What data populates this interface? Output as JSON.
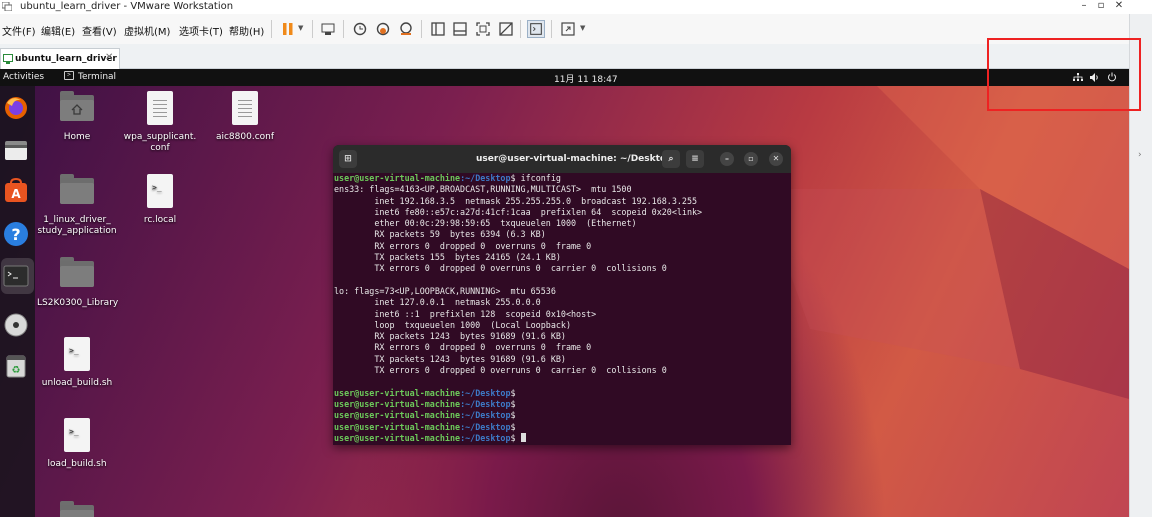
{
  "window": {
    "title": "ubuntu_learn_driver - VMware Workstation"
  },
  "menus": [
    "文件(F)",
    "编辑(E)",
    "查看(V)",
    "虚拟机(M)",
    "选项卡(T)",
    "帮助(H)"
  ],
  "tab": {
    "label": "ubuntu_learn_driver"
  },
  "guest": {
    "topbar": {
      "activities": "Activities",
      "app": "Terminal",
      "clock": "11月 11  18:47"
    },
    "desktop": [
      {
        "label": "Home",
        "kind": "home-folder"
      },
      {
        "label": "wpa_supplicant.\nconf",
        "kind": "document"
      },
      {
        "label": "aic8800.conf",
        "kind": "document"
      },
      {
        "label": "1_linux_driver_\nstudy_application",
        "kind": "folder"
      },
      {
        "label": "rc.local",
        "kind": "script"
      },
      {
        "label": "LS2K0300_Library",
        "kind": "folder"
      },
      {
        "label": "unload_build.sh",
        "kind": "script"
      },
      {
        "label": "load_build.sh",
        "kind": "script"
      }
    ]
  },
  "terminal": {
    "title": "user@user-virtual-machine: ~/Desktop",
    "prompt_user": "user@user-virtual-machine",
    "prompt_path": ":~/Desktop",
    "command": "$ ifconfig",
    "output": [
      "ens33: flags=4163<UP,BROADCAST,RUNNING,MULTICAST>  mtu 1500",
      "        inet 192.168.3.5  netmask 255.255.255.0  broadcast 192.168.3.255",
      "        inet6 fe80::e57c:a27d:41cf:1caa  prefixlen 64  scopeid 0x20<link>",
      "        ether 00:0c:29:98:59:65  txqueuelen 1000  (Ethernet)",
      "        RX packets 59  bytes 6394 (6.3 KB)",
      "        RX errors 0  dropped 0  overruns 0  frame 0",
      "        TX packets 155  bytes 24165 (24.1 KB)",
      "        TX errors 0  dropped 0 overruns 0  carrier 0  collisions 0",
      "",
      "lo: flags=73<UP,LOOPBACK,RUNNING>  mtu 65536",
      "        inet 127.0.0.1  netmask 255.0.0.0",
      "        inet6 ::1  prefixlen 128  scopeid 0x10<host>",
      "        loop  txqueuelen 1000  (Local Loopback)",
      "        RX packets 1243  bytes 91689 (91.6 KB)",
      "        RX errors 0  dropped 0  overruns 0  frame 0",
      "        TX packets 1243  bytes 91689 (91.6 KB)",
      "        TX errors 0  dropped 0 overruns 0  carrier 0  collisions 0",
      ""
    ],
    "prompt_suffix": "$",
    "empty_prompts": 5
  },
  "colors": {
    "annotation": "#e22222",
    "prompt_user": "#6cc85a",
    "prompt_path": "#3d79c6",
    "terminal_bg": "#300a24"
  }
}
